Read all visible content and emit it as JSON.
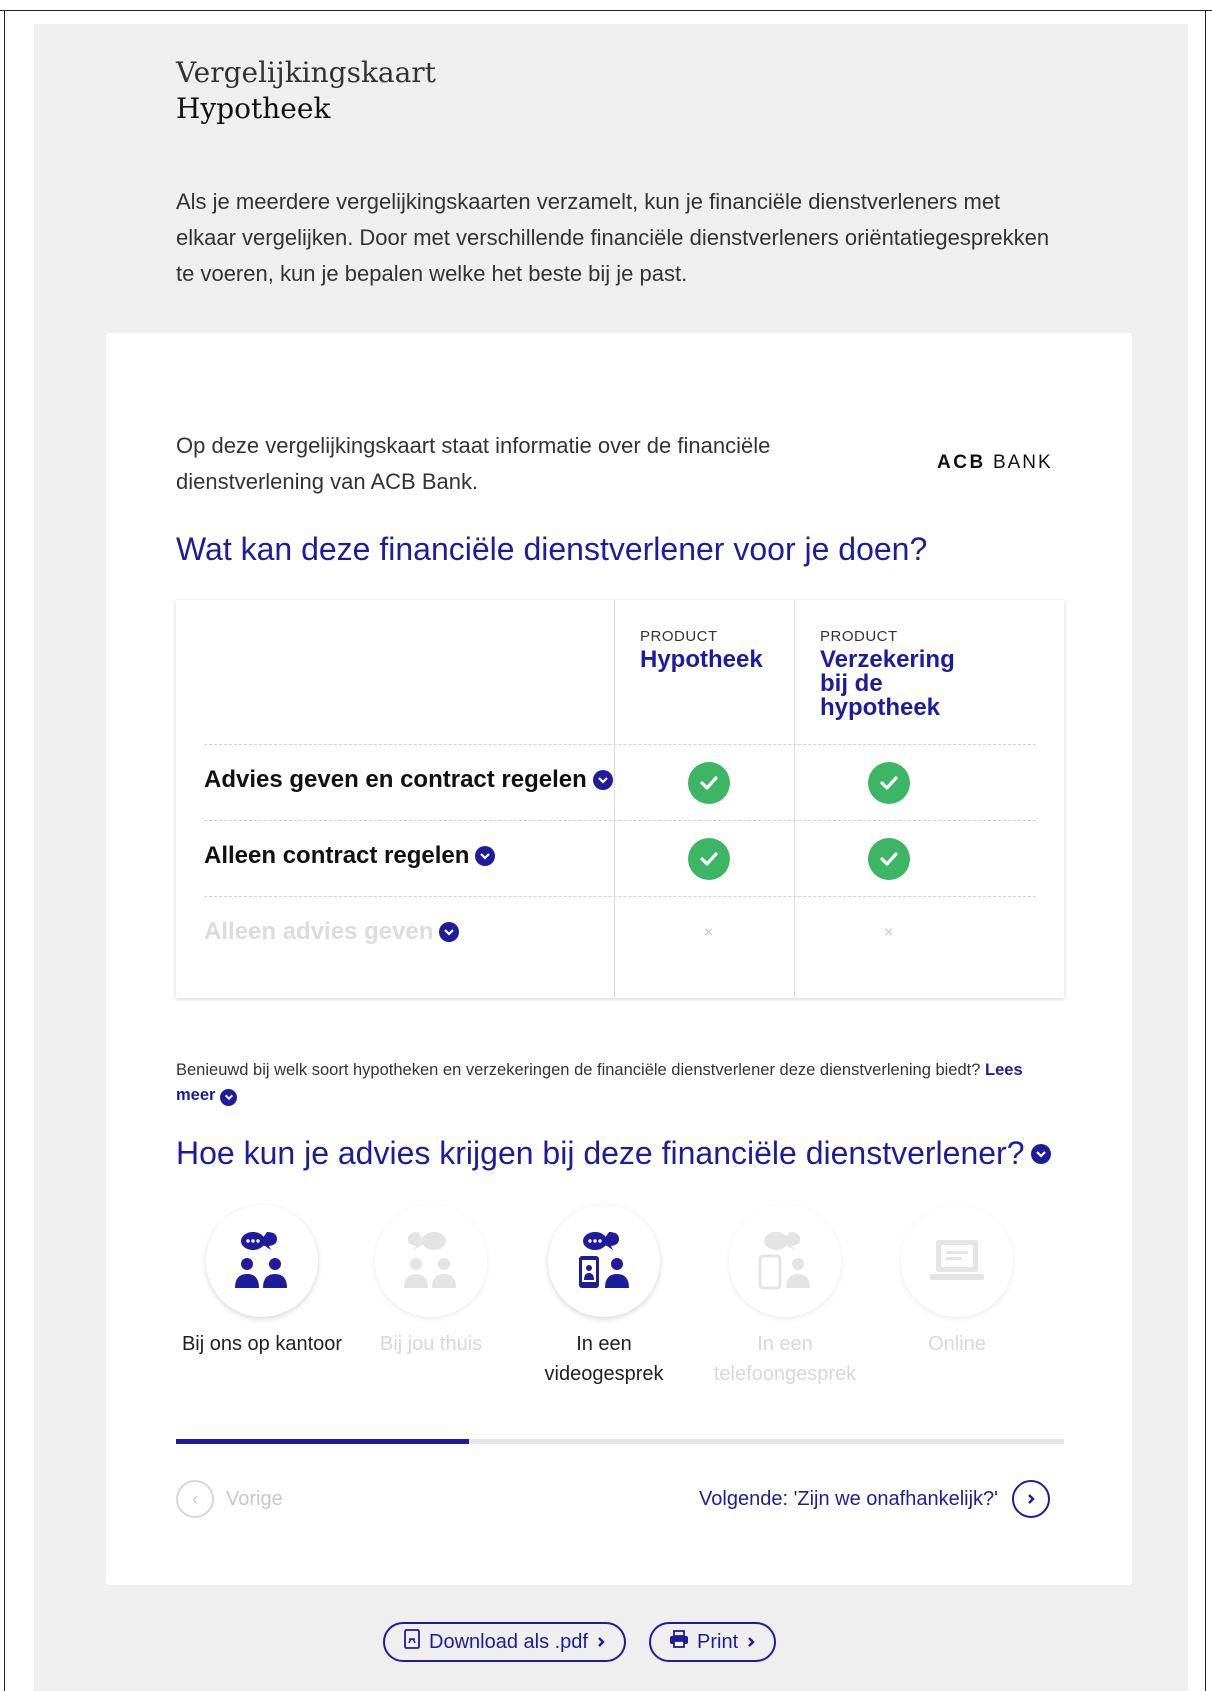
{
  "header": {
    "kicker": "Vergelijkingskaart",
    "title": "Hypotheek",
    "intro": "Als je meerdere vergelijkingskaarten verzamelt, kun je financiële dienstverleners met elkaar vergelijken. Door met verschillende financiële dienstverleners oriëntatiegesprekken te voeren, kun je bepalen welke het beste bij je past."
  },
  "card": {
    "intro": "Op deze vergelijkingskaart staat informatie over de financiële dienstverlening van ACB Bank.",
    "logo_bold": "ACB",
    "logo_light": "BANK",
    "question1": "Wat kan deze financiële dienstverlener voor je doen?",
    "products": [
      {
        "kicker": "PRODUCT",
        "name": "Hypotheek"
      },
      {
        "kicker": "PRODUCT",
        "name": "Verzekering bij de hypotheek"
      }
    ],
    "rows": [
      {
        "label": "Advies geven en contract regelen",
        "enabled": true,
        "values": [
          "check",
          "check"
        ]
      },
      {
        "label": "Alleen contract regelen",
        "enabled": true,
        "values": [
          "check",
          "check"
        ]
      },
      {
        "label": "Alleen advies geven",
        "enabled": false,
        "values": [
          "×",
          "×"
        ]
      }
    ],
    "benieuwd_text": "Benieuwd bij welk soort hypotheken en verzekeringen de financiële dienstverlener deze dienstverlening biedt?",
    "lees_meer": "Lees meer",
    "question2": "Hoe kun je advies krijgen bij deze financiële dienstverlener?",
    "channels": [
      {
        "label": "Bij ons op kantoor",
        "active": true,
        "icon": "office-meeting-icon"
      },
      {
        "label": "Bij jou thuis",
        "active": false,
        "icon": "home-meeting-icon"
      },
      {
        "label": "In een videogesprek",
        "active": true,
        "icon": "video-call-icon"
      },
      {
        "label": "In een telefoongesprek",
        "active": false,
        "icon": "phone-call-icon"
      },
      {
        "label": "Online",
        "active": false,
        "icon": "laptop-icon"
      }
    ],
    "progress_fraction": 0.33,
    "prev_label": "Vorige",
    "next_label": "Volgende: 'Zijn we onafhankelijk?'"
  },
  "actions": {
    "download_label": "Download als .pdf",
    "print_label": "Print"
  },
  "colors": {
    "accent": "#1d1d9c",
    "check": "#3cb664",
    "panel": "#efefef"
  }
}
